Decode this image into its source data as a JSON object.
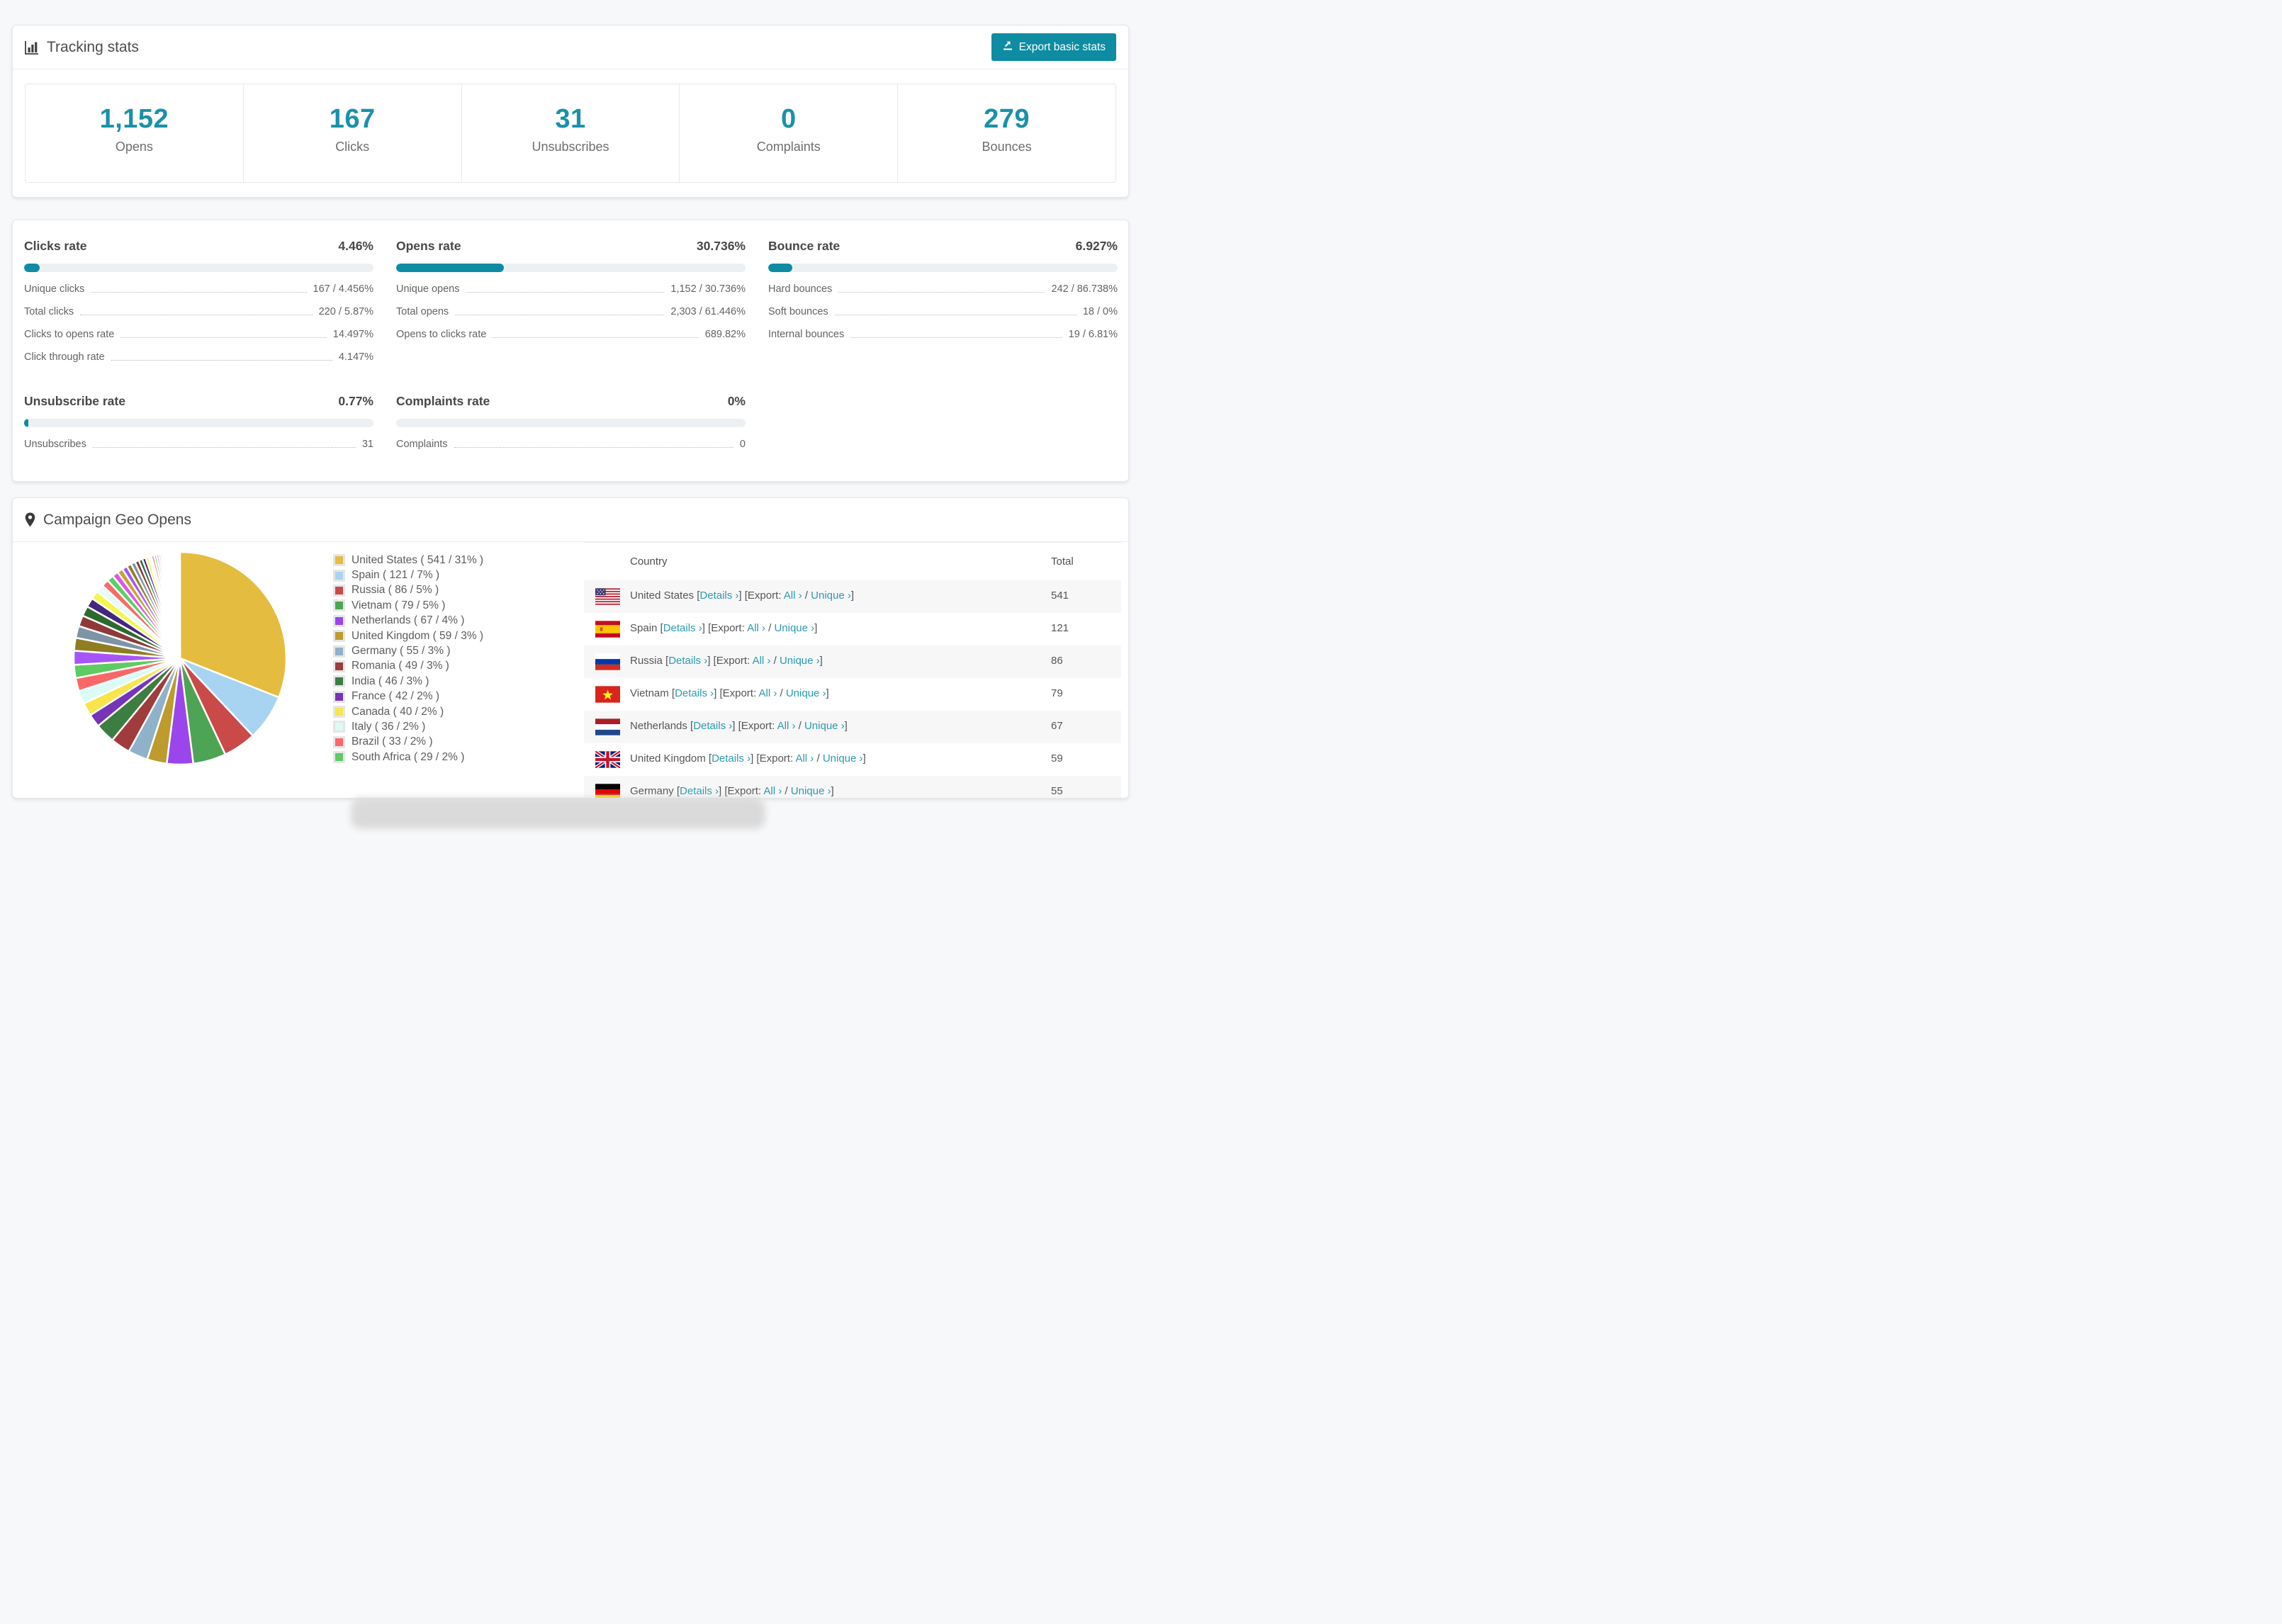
{
  "colors": {
    "accent_teal": "#0e8ca1",
    "stat_number_teal": "#1a91a8",
    "link_teal": "#2b9ab0",
    "bar_track": "#edf0f3",
    "row_stripe": "#f7f7f8"
  },
  "tracking": {
    "title": "Tracking stats",
    "export_button": "Export basic stats",
    "stats": [
      {
        "value": "1,152",
        "label": "Opens"
      },
      {
        "value": "167",
        "label": "Clicks"
      },
      {
        "value": "31",
        "label": "Unsubscribes"
      },
      {
        "value": "0",
        "label": "Complaints"
      },
      {
        "value": "279",
        "label": "Bounces"
      }
    ]
  },
  "rates": {
    "blocks": [
      {
        "title": "Clicks rate",
        "percent": "4.46%",
        "fill": 4.46,
        "rows": [
          [
            "Unique clicks",
            "167 / 4.456%"
          ],
          [
            "Total clicks",
            "220 / 5.87%"
          ],
          [
            "Clicks to opens rate",
            "14.497%"
          ],
          [
            "Click through rate",
            "4.147%"
          ]
        ]
      },
      {
        "title": "Opens rate",
        "percent": "30.736%",
        "fill": 30.736,
        "rows": [
          [
            "Unique opens",
            "1,152 / 30.736%"
          ],
          [
            "Total opens",
            "2,303 / 61.446%"
          ],
          [
            "Opens to clicks rate",
            "689.82%"
          ]
        ]
      },
      {
        "title": "Bounce rate",
        "percent": "6.927%",
        "fill": 6.927,
        "rows": [
          [
            "Hard bounces",
            "242 / 86.738%"
          ],
          [
            "Soft bounces",
            "18 / 0%"
          ],
          [
            "Internal bounces",
            "19 / 6.81%"
          ]
        ]
      },
      {
        "title": "Unsubscribe rate",
        "percent": "0.77%",
        "fill": 0.77,
        "rows": [
          [
            "Unsubscribes",
            "31"
          ]
        ]
      },
      {
        "title": "Complaints rate",
        "percent": "0%",
        "fill": 0,
        "rows": [
          [
            "Complaints",
            "0"
          ]
        ]
      }
    ]
  },
  "geo": {
    "title": "Campaign Geo Opens",
    "table_headers": {
      "country": "Country",
      "total": "Total"
    },
    "links": {
      "details": "Details ›",
      "export_prefix": "Export:",
      "all": "All ›",
      "unique": "Unique ›"
    },
    "rows": [
      {
        "country": "United States",
        "total": "541",
        "flag": "us"
      },
      {
        "country": "Spain",
        "total": "121",
        "flag": "es"
      },
      {
        "country": "Russia",
        "total": "86",
        "flag": "ru"
      },
      {
        "country": "Vietnam",
        "total": "79",
        "flag": "vn"
      },
      {
        "country": "Netherlands",
        "total": "67",
        "flag": "nl"
      },
      {
        "country": "United Kingdom",
        "total": "59",
        "flag": "gb"
      },
      {
        "country": "Germany",
        "total": "55",
        "flag": "de"
      }
    ],
    "chart_data": {
      "type": "pie",
      "title": "Campaign Geo Opens",
      "legend_position": "right",
      "start_angle_deg_from_north": 0,
      "direction": "clockwise",
      "slices": [
        {
          "label": "United States",
          "value": 541,
          "pct": 31,
          "color": "#e4bc3f"
        },
        {
          "label": "Spain",
          "value": 121,
          "pct": 7,
          "color": "#a8d4f2"
        },
        {
          "label": "Russia",
          "value": 86,
          "pct": 5,
          "color": "#ca4a4a"
        },
        {
          "label": "Vietnam",
          "value": 79,
          "pct": 5,
          "color": "#4da455"
        },
        {
          "label": "Netherlands",
          "value": 67,
          "pct": 4,
          "color": "#9b45ec"
        },
        {
          "label": "United Kingdom",
          "value": 59,
          "pct": 3,
          "color": "#bd9b2c"
        },
        {
          "label": "Germany",
          "value": 55,
          "pct": 3,
          "color": "#8fb1c9"
        },
        {
          "label": "Romania",
          "value": 49,
          "pct": 3,
          "color": "#a03c3c"
        },
        {
          "label": "India",
          "value": 46,
          "pct": 3,
          "color": "#3c7d42"
        },
        {
          "label": "France",
          "value": 42,
          "pct": 2,
          "color": "#7634b8"
        },
        {
          "label": "Canada",
          "value": 40,
          "pct": 2,
          "color": "#f8e44d"
        },
        {
          "label": "Italy",
          "value": 36,
          "pct": 2,
          "color": "#dafcf4"
        },
        {
          "label": "Brazil",
          "value": 33,
          "pct": 2,
          "color": "#f96868"
        },
        {
          "label": "South Africa",
          "value": 29,
          "pct": 2,
          "color": "#5ecb63"
        }
      ],
      "others_pct": 26,
      "others_note": "many small unlabeled countries, shrinking slices",
      "tail_palette": [
        "#a855f7",
        "#8f7d22",
        "#7d93a6",
        "#8f3a3a",
        "#2d6a2f",
        "#45277d",
        "#f5f54d",
        "#e6fcf5",
        "#f96a6a",
        "#58d063",
        "#df57df",
        "#c9a22b"
      ]
    }
  }
}
